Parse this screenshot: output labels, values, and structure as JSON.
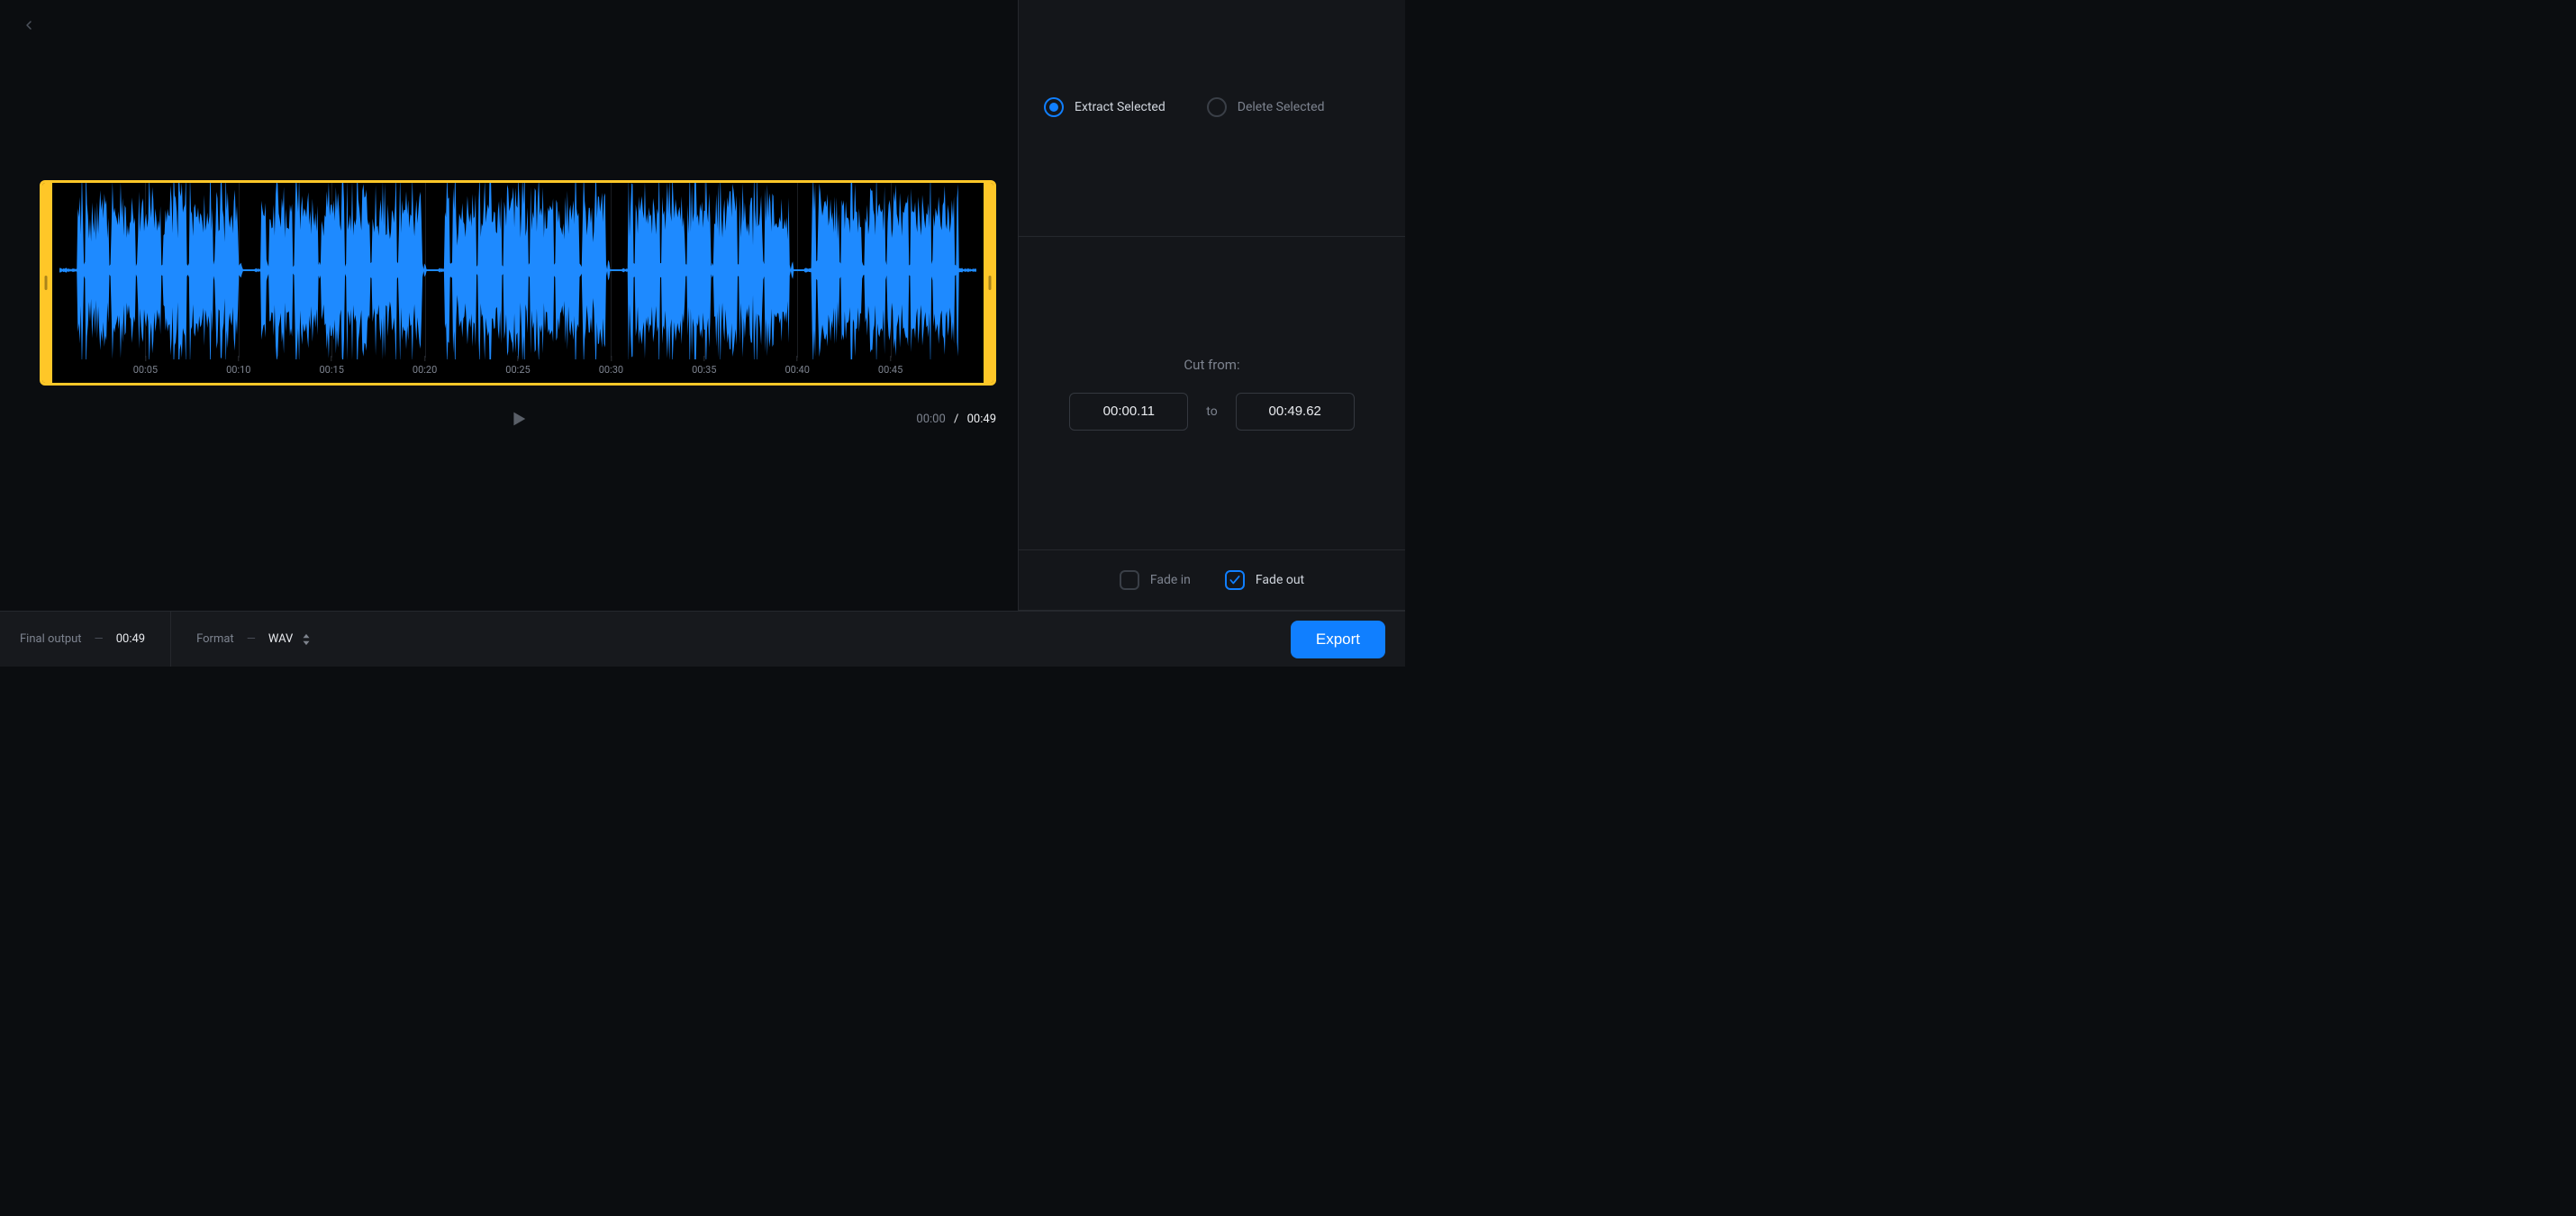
{
  "actions": {
    "extract_selected": "Extract Selected",
    "delete_selected": "Delete Selected",
    "selected_mode": "extract"
  },
  "cut": {
    "title": "Cut from:",
    "from": "00:00.11",
    "to_label": "to",
    "to": "00:49.62"
  },
  "fades": {
    "fade_in_label": "Fade in",
    "fade_in_checked": false,
    "fade_out_label": "Fade out",
    "fade_out_checked": true
  },
  "transport": {
    "current": "00:00",
    "separator": "/",
    "total": "00:49"
  },
  "timeline": {
    "ticks": [
      "00:05",
      "00:10",
      "00:15",
      "00:20",
      "00:25",
      "00:30",
      "00:35",
      "00:40",
      "00:45"
    ]
  },
  "footer": {
    "final_output_label": "Final output",
    "final_output_value": "00:49",
    "format_label": "Format",
    "format_value": "WAV",
    "export": "Export"
  }
}
